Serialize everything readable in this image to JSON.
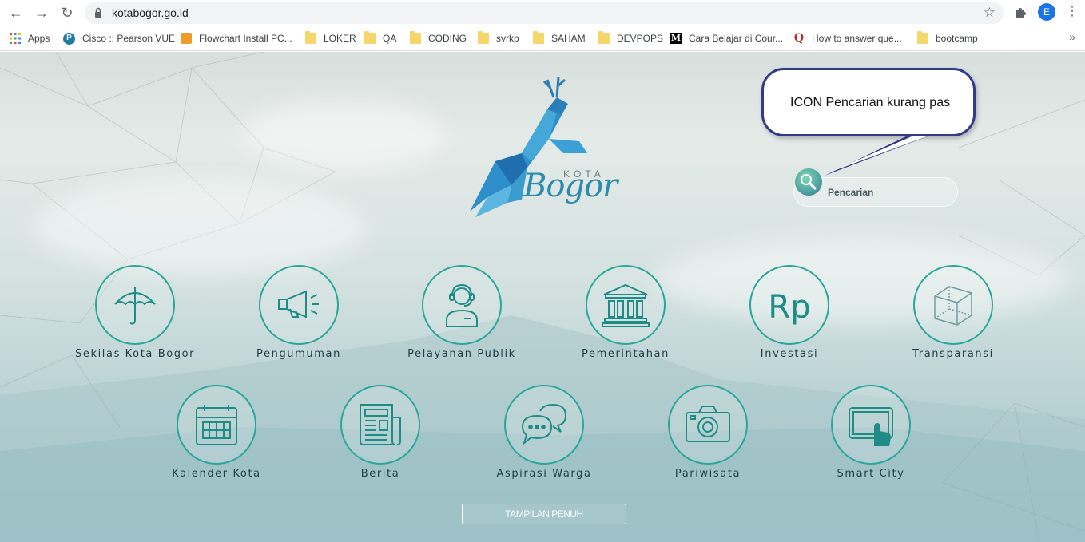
{
  "browser": {
    "url": "kotabogor.go.id",
    "profile_initial": "E",
    "bookmarks": [
      {
        "label": "Apps",
        "icon": "apps-grid-icon"
      },
      {
        "label": "Cisco :: Pearson VUE",
        "icon": "pearson-icon"
      },
      {
        "label": "Flowchart Install PC...",
        "icon": "flowchart-icon"
      },
      {
        "label": "LOKER",
        "icon": "folder-icon"
      },
      {
        "label": "QA",
        "icon": "folder-icon"
      },
      {
        "label": "CODING",
        "icon": "folder-icon"
      },
      {
        "label": "svrkp",
        "icon": "folder-icon"
      },
      {
        "label": "SAHAM",
        "icon": "folder-icon"
      },
      {
        "label": "DEVPOPS",
        "icon": "folder-icon"
      },
      {
        "label": "Cara Belajar di Cour...",
        "icon": "medium-icon"
      },
      {
        "label": "How to answer que...",
        "icon": "quora-icon"
      },
      {
        "label": "bootcamp",
        "icon": "folder-icon"
      }
    ]
  },
  "header": {
    "logo_kota": "KOTA",
    "logo_word": "Bogor"
  },
  "callout": {
    "text": "ICON Pencarian kurang pas"
  },
  "search": {
    "placeholder": "Pencarian"
  },
  "menu": {
    "row1": [
      {
        "label": "Sekilas Kota Bogor",
        "icon": "umbrella-icon"
      },
      {
        "label": "Pengumuman",
        "icon": "megaphone-icon"
      },
      {
        "label": "Pelayanan Publik",
        "icon": "customer-service-icon"
      },
      {
        "label": "Pemerintahan",
        "icon": "government-building-icon"
      },
      {
        "label": "Investasi",
        "icon": "rupiah-icon"
      },
      {
        "label": "Transparansi",
        "icon": "cube-icon"
      }
    ],
    "row2": [
      {
        "label": "Kalender Kota",
        "icon": "calendar-icon"
      },
      {
        "label": "Berita",
        "icon": "newspaper-icon"
      },
      {
        "label": "Aspirasi Warga",
        "icon": "chat-bubbles-icon"
      },
      {
        "label": "Pariwisata",
        "icon": "camera-icon"
      },
      {
        "label": "Smart City",
        "icon": "touch-tablet-icon"
      }
    ]
  },
  "footer": {
    "full_view_label": "TAMPILAN PENUH"
  },
  "colors": {
    "accent": "#2aa79a",
    "callout_border": "#343a8a",
    "label_text": "#1e3d45"
  }
}
